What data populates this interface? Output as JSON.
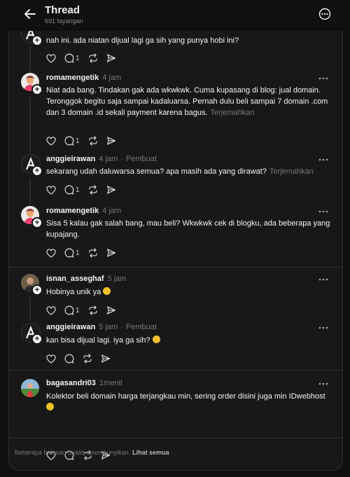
{
  "header": {
    "title": "Thread",
    "views": "691 tayangan"
  },
  "posts": [
    {
      "username": "",
      "time": "",
      "creator_tag": "",
      "text": "nah ini. ada niatan dijual lagi ga sih yang punya hobi ini?",
      "translate": "",
      "replies": "1"
    },
    {
      "username": "romamengetik",
      "time": "4 jam",
      "creator_tag": "",
      "text": "Niat ada bang. Tindakan gak ada wkwkwk. Cuma kupasang di blog: jual domain. Teronggok begitu saja sampai kadaluarsa. Pernah dulu beli sampai 7 domain .com dan 3 domain .id sekali payment karena bagus.",
      "translate": "Terjemahkan",
      "replies": "1"
    },
    {
      "username": "anggieirawan",
      "time": "4 jam",
      "creator_tag": "· Pembuat",
      "text": "sekarang udah daluwarsa semua? apa masih ada yang dirawat?",
      "translate": "Terjemahkan",
      "replies": "1"
    },
    {
      "username": "romamengetik",
      "time": "4 jam",
      "creator_tag": "",
      "text": "Sisa 5 kalau gak salah bang, mau beli? Wkwkwk cek di blogku, ada beberapa yang kupajang.",
      "translate": "",
      "replies": "1"
    },
    {
      "username": "isnan_asseghaf",
      "time": "5 jam",
      "creator_tag": "",
      "text": "Hobinya unik ya",
      "translate": "",
      "replies": "1"
    },
    {
      "username": "anggieirawan",
      "time": "5 jam",
      "creator_tag": "· Pembuat",
      "text": "kan bisa dijual lagi. iya ga sih?",
      "translate": "",
      "replies": ""
    },
    {
      "username": "bagasandri03",
      "time": "1menit",
      "creator_tag": "",
      "text": "Kolektor beli domain harga terjangkau min, sering order disini juga min IDwebhost",
      "translate": "",
      "replies": ""
    }
  ],
  "footer": {
    "note": "Beberapa balasan sudah disembunyikan.",
    "link": "Lihat semua"
  },
  "colors": {
    "background": "#101010",
    "card": "#181818",
    "border": "#2e2e2e",
    "muted": "#777777"
  },
  "icons": [
    "back-arrow-icon",
    "more-icon",
    "heart-icon",
    "comment-icon",
    "repost-icon",
    "share-icon",
    "plus-icon",
    "emoji-icon"
  ]
}
